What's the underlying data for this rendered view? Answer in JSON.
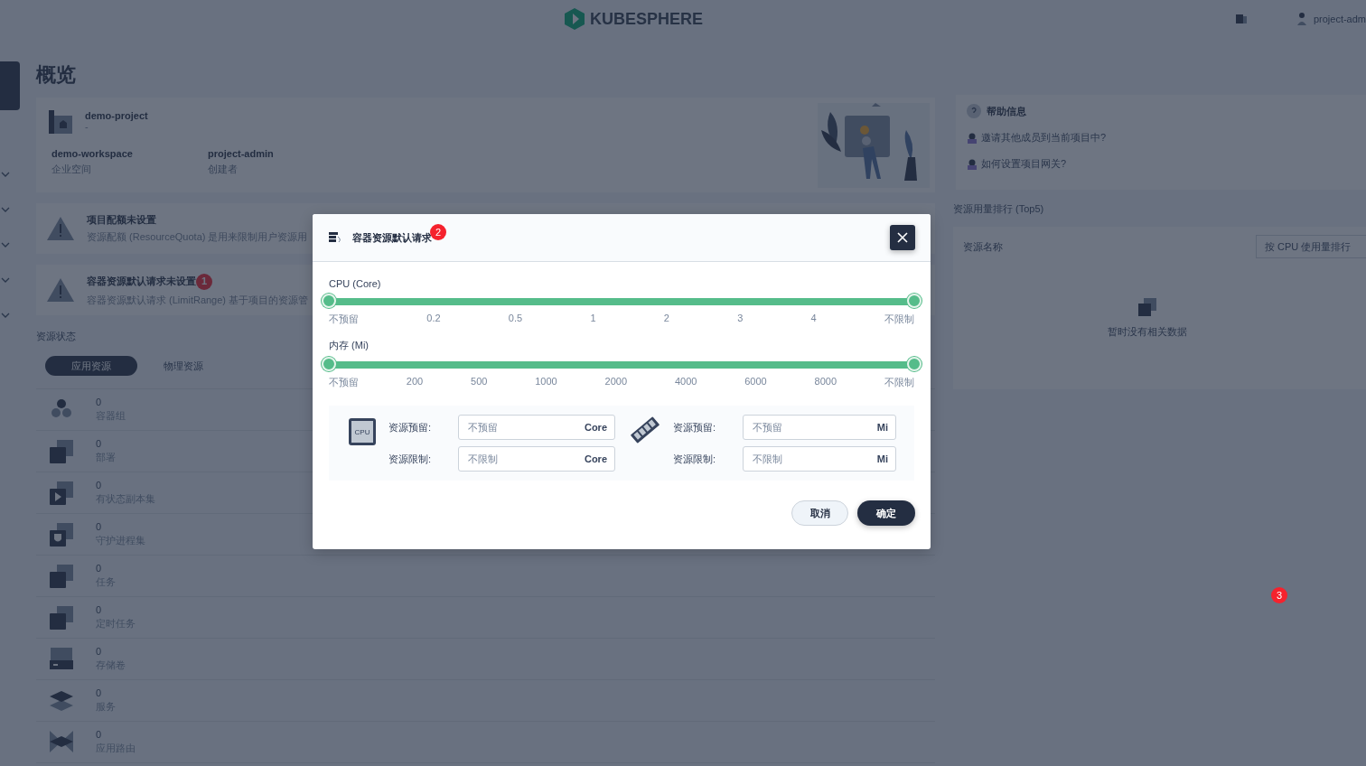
{
  "header": {
    "logo_text": "KUBESPHERE",
    "user": "project-adm"
  },
  "page_title": "概览",
  "project_card": {
    "name": "demo-project",
    "description": "-",
    "fields": [
      {
        "value": "demo-workspace",
        "label": "企业空间"
      },
      {
        "value": "project-admin",
        "label": "创建者"
      }
    ]
  },
  "alerts": [
    {
      "title": "项目配额未设置",
      "description": "资源配额 (ResourceQuota) 是用来限制用户资源用"
    },
    {
      "title": "容器资源默认请求未设置",
      "description": "容器资源默认请求 (LimitRange) 基于项目的资源管",
      "badge": "1"
    }
  ],
  "resource_status": {
    "title": "资源状态",
    "tabs": [
      {
        "label": "应用资源",
        "selected": true
      },
      {
        "label": "物理资源",
        "selected": false
      }
    ],
    "items": [
      {
        "kind": "pod",
        "count": "0",
        "label": "容器组"
      },
      {
        "kind": "deployment",
        "count": "0",
        "label": "部署"
      },
      {
        "kind": "statefulset",
        "count": "0",
        "label": "有状态副本集"
      },
      {
        "kind": "daemonset",
        "count": "0",
        "label": "守护进程集"
      },
      {
        "kind": "job",
        "count": "0",
        "label": "任务"
      },
      {
        "kind": "cronjob",
        "count": "0",
        "label": "定时任务"
      },
      {
        "kind": "volume",
        "count": "0",
        "label": "存储卷"
      },
      {
        "kind": "service",
        "count": "0",
        "label": "服务"
      },
      {
        "kind": "route",
        "count": "0",
        "label": "应用路由"
      }
    ]
  },
  "help": {
    "title": "帮助信息",
    "links": [
      "邀请其他成员到当前项目中?",
      "如何设置项目网关?"
    ]
  },
  "ranking": {
    "title": "资源用量排行 (Top5)",
    "column": "资源名称",
    "sort_select": "按 CPU 使用量排行",
    "empty": "暂时没有相关数据"
  },
  "modal": {
    "title": "容器资源默认请求",
    "badge": "2",
    "sliders": [
      {
        "label": "CPU (Core)",
        "level": 1,
        "ticks": [
          "不预留",
          "0.2",
          "0.5",
          "1",
          "2",
          "3",
          "4",
          "不限制"
        ]
      },
      {
        "label": "内存 (Mi)",
        "level": 1,
        "ticks": [
          "不预留",
          "200",
          "500",
          "1000",
          "2000",
          "4000",
          "6000",
          "8000",
          "不限制"
        ]
      }
    ],
    "resources": [
      {
        "kind": "cpu",
        "icon_text": "CPU",
        "fields": [
          {
            "label": "资源预留:",
            "placeholder": "不预留",
            "unit": "Core"
          },
          {
            "label": "资源限制:",
            "placeholder": "不限制",
            "unit": "Core"
          }
        ]
      },
      {
        "kind": "memory",
        "fields": [
          {
            "label": "资源预留:",
            "placeholder": "不预留",
            "unit": "Mi"
          },
          {
            "label": "资源限制:",
            "placeholder": "不限制",
            "unit": "Mi"
          }
        ]
      }
    ],
    "buttons": [
      {
        "label": "取消",
        "kind": "secondary"
      },
      {
        "label": "确定",
        "kind": "primary"
      }
    ]
  },
  "annotation_badge": "3"
}
